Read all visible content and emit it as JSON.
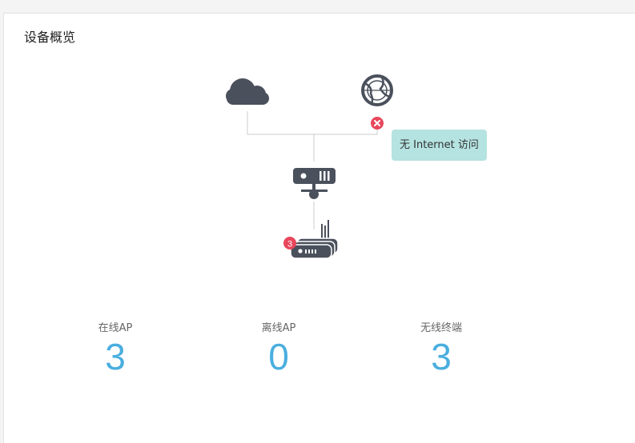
{
  "panel": {
    "title": "设备概览"
  },
  "topology": {
    "nodes": {
      "cloud": {
        "icon": "cloud-icon"
      },
      "internet": {
        "icon": "globe-icon",
        "status": "error",
        "status_icon": "error-x-icon"
      },
      "gateway": {
        "icon": "gateway-icon"
      },
      "ap_group": {
        "icon": "wireless-router-icon",
        "badge": "3"
      }
    },
    "tooltip": "无 Internet 访问",
    "colors": {
      "icon": "#4a505c",
      "error": "#e8475c",
      "line": "#cccccc",
      "tooltip_bg": "#b4e3e1"
    }
  },
  "stats": [
    {
      "label": "在线AP",
      "value": "3"
    },
    {
      "label": "离线AP",
      "value": "0"
    },
    {
      "label": "无线终端",
      "value": "3"
    }
  ],
  "colors": {
    "stat_value": "#4aaedf"
  }
}
